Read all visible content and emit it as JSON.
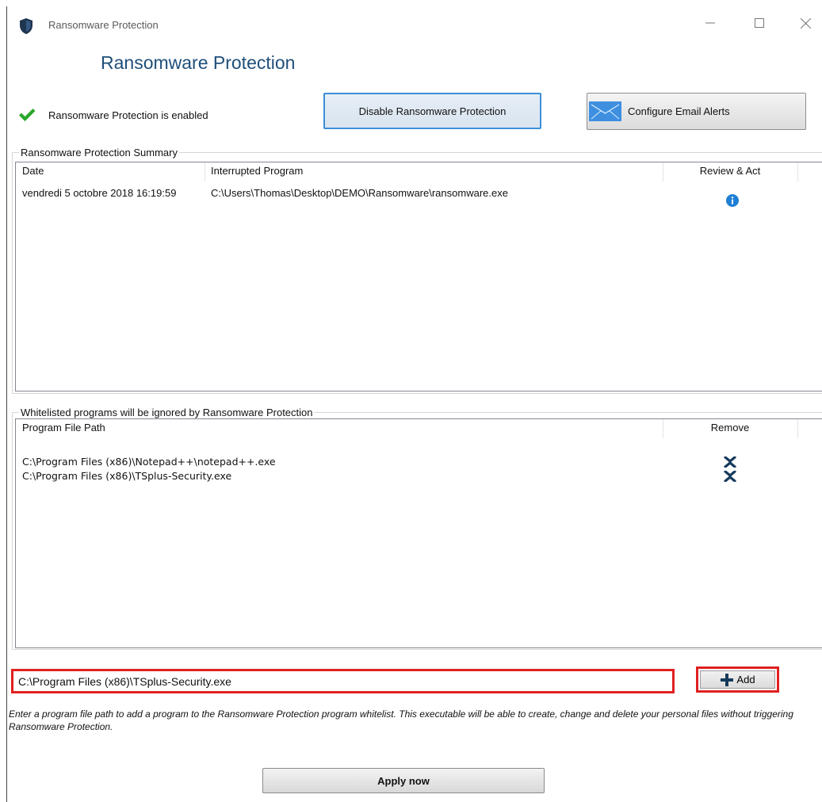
{
  "window": {
    "title": "Ransomware Protection",
    "heading": "Ransomware Protection",
    "accent_color": "#2b6fb8"
  },
  "status": {
    "text": "Ransomware Protection is enabled",
    "icon": "check-icon",
    "color": "#2aa82a"
  },
  "toolbar": {
    "disable_label": "Disable Ransomware Protection",
    "email_label": "Configure Email Alerts",
    "email_icon": "mail-icon"
  },
  "summary": {
    "legend": "Ransomware Protection Summary",
    "columns": [
      "Date",
      "Interrupted Program",
      "Review & Act"
    ],
    "rows": [
      {
        "date": "vendredi 5 octobre 2018 16:19:59",
        "program": "C:\\Users\\Thomas\\Desktop\\DEMO\\Ransomware\\ransomware.exe",
        "action_icon": "info-icon"
      }
    ]
  },
  "whitelist": {
    "legend": "Whitelisted programs will be ignored by Ransomware Protection",
    "columns": [
      "Program File Path",
      "Remove"
    ],
    "rows": [
      {
        "path": "C:\\Program Files (x86)\\Notepad++\\notepad++.exe",
        "remove_icon": "close-x-icon"
      },
      {
        "path": "C:\\Program Files (x86)\\TSplus-Security.exe",
        "remove_icon": "close-x-icon"
      }
    ]
  },
  "add": {
    "input_value": "C:\\Program Files (x86)\\TSplus-Security.exe",
    "button_label": "Add",
    "highlight_color": "#e02020"
  },
  "help_text": "Enter a program file path to add a program to the Ransomware Protection program whitelist. This executable will be able to create, change and delete your personal files without triggering Ransomware Protection.",
  "apply_label": "Apply now"
}
